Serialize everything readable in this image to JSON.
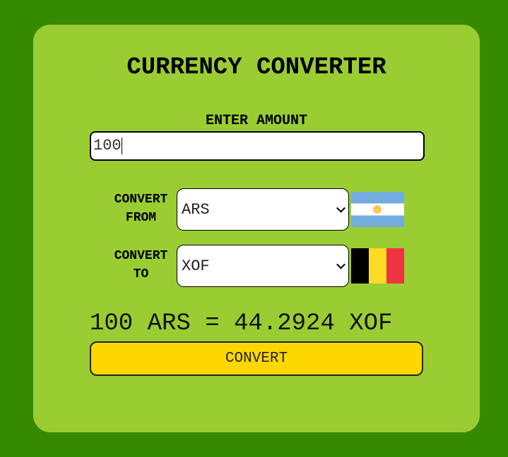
{
  "app": {
    "title": "CURRENCY CONVERTER"
  },
  "amount": {
    "label": "ENTER AMOUNT",
    "value": "100"
  },
  "from": {
    "label_line1": "CONVERT",
    "label_line2": "FROM",
    "selected": "ARS",
    "flag": "argentina-flag"
  },
  "to": {
    "label_line1": "CONVERT",
    "label_line2": "TO",
    "selected": "XOF",
    "flag": "belgium-flag"
  },
  "result": {
    "text": "100 ARS = 44.2924 XOF"
  },
  "actions": {
    "convert_label": "CONVERT"
  },
  "colors": {
    "page_background": "#368a00",
    "card_background": "#9acd32",
    "button_background": "#ffd700",
    "flag_ar_blue": "#74acdf",
    "flag_ar_sun": "#f6b40e",
    "flag_be_black": "#000000",
    "flag_be_yellow": "#fdda24",
    "flag_be_red": "#ef3340"
  }
}
